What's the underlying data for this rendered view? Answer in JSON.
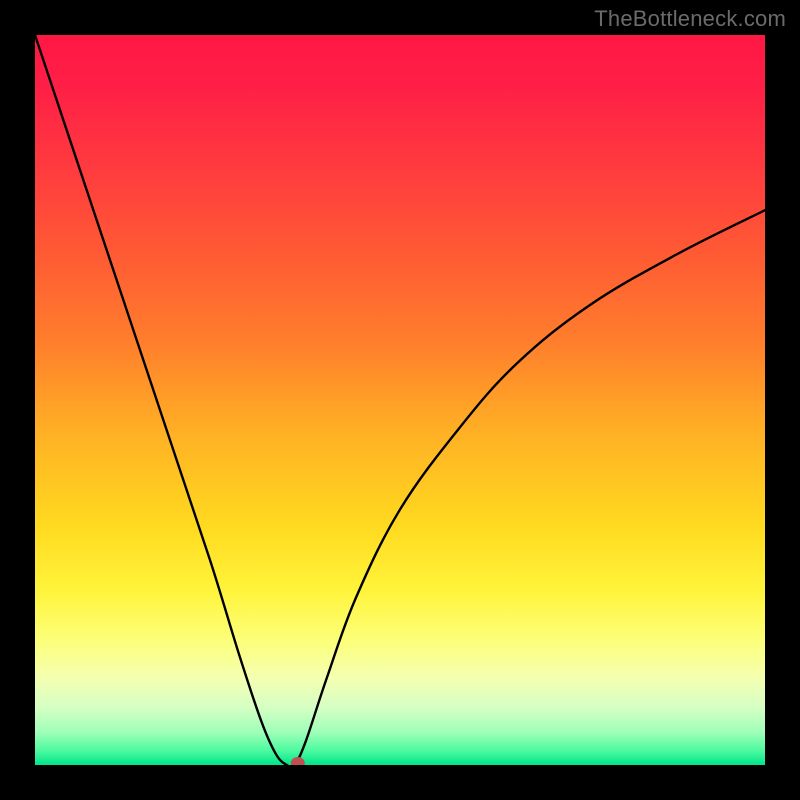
{
  "watermark": "TheBottleneck.com",
  "chart_data": {
    "type": "line",
    "title": "",
    "xlabel": "",
    "ylabel": "",
    "x_range": [
      0,
      100
    ],
    "y_range": [
      0,
      100
    ],
    "background_gradient_stops": [
      {
        "offset": 0.0,
        "color": "#ff1744"
      },
      {
        "offset": 0.07,
        "color": "#ff1f46"
      },
      {
        "offset": 0.18,
        "color": "#ff3a3f"
      },
      {
        "offset": 0.3,
        "color": "#ff5a34"
      },
      {
        "offset": 0.42,
        "color": "#ff7e2c"
      },
      {
        "offset": 0.55,
        "color": "#ffb224"
      },
      {
        "offset": 0.67,
        "color": "#ffd91f"
      },
      {
        "offset": 0.76,
        "color": "#fff43a"
      },
      {
        "offset": 0.83,
        "color": "#fcff7a"
      },
      {
        "offset": 0.88,
        "color": "#f4ffb0"
      },
      {
        "offset": 0.92,
        "color": "#d7ffc4"
      },
      {
        "offset": 0.955,
        "color": "#9fffb8"
      },
      {
        "offset": 0.98,
        "color": "#4efaa0"
      },
      {
        "offset": 1.0,
        "color": "#00e58a"
      }
    ],
    "series": [
      {
        "name": "bottleneck-curve",
        "x": [
          0,
          6,
          12,
          18,
          24,
          28,
          31,
          33,
          34.5,
          35.5,
          37,
          40,
          44,
          50,
          58,
          66,
          76,
          88,
          100
        ],
        "values": [
          100,
          82,
          64,
          46,
          28,
          15,
          6,
          1.5,
          0,
          0,
          3,
          12,
          23,
          35,
          46,
          55,
          63,
          70,
          76
        ]
      }
    ],
    "marker": {
      "x": 36,
      "y": 0,
      "color": "#c05050",
      "rx": 7,
      "ry": 6
    }
  }
}
